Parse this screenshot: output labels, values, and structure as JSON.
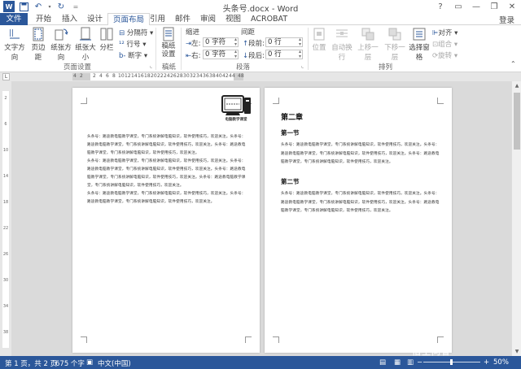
{
  "titlebar": {
    "title": "头条号.docx - Word",
    "controls": [
      "?",
      "▭",
      "—",
      "❐",
      "✕"
    ]
  },
  "tabs": {
    "file": "文件",
    "items": [
      "开始",
      "插入",
      "设计",
      "页面布局",
      "引用",
      "邮件",
      "审阅",
      "视图",
      "ACROBAT"
    ],
    "active": "页面布局",
    "login": "登录"
  },
  "ribbon": {
    "page_setup": {
      "buttons": [
        "文字方向",
        "页边距",
        "纸张方向",
        "纸张大小",
        "分栏"
      ],
      "small": [
        "分隔符",
        "行号",
        "断字"
      ],
      "label": "页面设置"
    },
    "draft": {
      "button": "稿纸设置",
      "label": "稿纸"
    },
    "paragraph": {
      "indent_title": "缩进",
      "spacing_title": "间距",
      "left_label": "左:",
      "left_value": "0 字符",
      "right_label": "右:",
      "right_value": "0 字符",
      "before_label": "段前:",
      "before_value": "0 行",
      "after_label": "段后:",
      "after_value": "0 行",
      "label": "段落"
    },
    "arrange": {
      "buttons": [
        "位置",
        "自动换行",
        "上移一层",
        "下移一层",
        "选择窗格"
      ],
      "small": [
        "对齐",
        "组合",
        "旋转"
      ],
      "label": "排列"
    }
  },
  "ruler": {
    "corner": "L",
    "numbers": [
      "4",
      "2",
      "2",
      "4",
      "6",
      "8",
      "10",
      "12",
      "14",
      "16",
      "18",
      "20",
      "22",
      "24",
      "26",
      "28",
      "30",
      "32",
      "34",
      "36",
      "38",
      "40",
      "42",
      "44",
      "48"
    ]
  },
  "page1": {
    "logo_text": "电脑教学课堂",
    "paragraphs": [
      "头条号：路途教电脑教学课堂，专门系统讲解电脑知识，软件使用技巧，欢迎关注。头条号：路途教电脑教学课堂，专门系统讲解电脑知识，软件使用技巧，欢迎关注。头条号：路途教电脑教学课堂，专门系统讲解电脑知识，软件使用技巧，欢迎关注。",
      "头条号：路途教电脑教学课堂，专门系统讲解电脑知识，软件使用技巧，欢迎关注。头条号：路途教电脑教学课堂，专门系统讲解电脑知识，软件使用技巧，欢迎关注。头条号：路途教电脑教学课堂，专门系统讲解电脑知识，软件使用技巧，欢迎关注。头条号：路途教电脑教学课堂，专门系统讲解电脑知识，软件使用技巧，欢迎关注。",
      "头条号：路途教电脑教学课堂，专门系统讲解电脑知识，软件使用技巧，欢迎关注。头条号：路途教电脑教学课堂，专门系统讲解电脑知识，软件使用技巧，欢迎关注。"
    ]
  },
  "page2": {
    "chapter": "第二章",
    "section1": "第一节",
    "section1_text": "头条号：路途教电脑教学课堂，专门系统讲解电脑知识，软件使用技巧，欢迎关注。头条号：路途教电脑教学课堂，专门系统讲解电脑知识，软件使用技巧，欢迎关注。头条号：路途教电脑教学课堂，专门系统讲解电脑知识，软件使用技巧，欢迎关注。",
    "section2": "第二节",
    "section2_text": "头条号：路途教电脑教学课堂，专门系统讲解电脑知识，软件使用技巧，欢迎关注。头条号：路途教电脑教学课堂，专门系统讲解电脑知识，软件使用技巧，欢迎关注。头条号：路途教电脑教学课堂，专门系统讲解电脑知识，软件使用技巧，欢迎关注。"
  },
  "status": {
    "page": "第 1 页，共 2 页",
    "words": "675 个字",
    "lang": "中文(中国)",
    "zoom": "50%",
    "zoom_level": 0.5,
    "watermark": "悟空问答"
  },
  "colors": {
    "accent": "#2b579a",
    "doc_bg": "#dadada"
  }
}
